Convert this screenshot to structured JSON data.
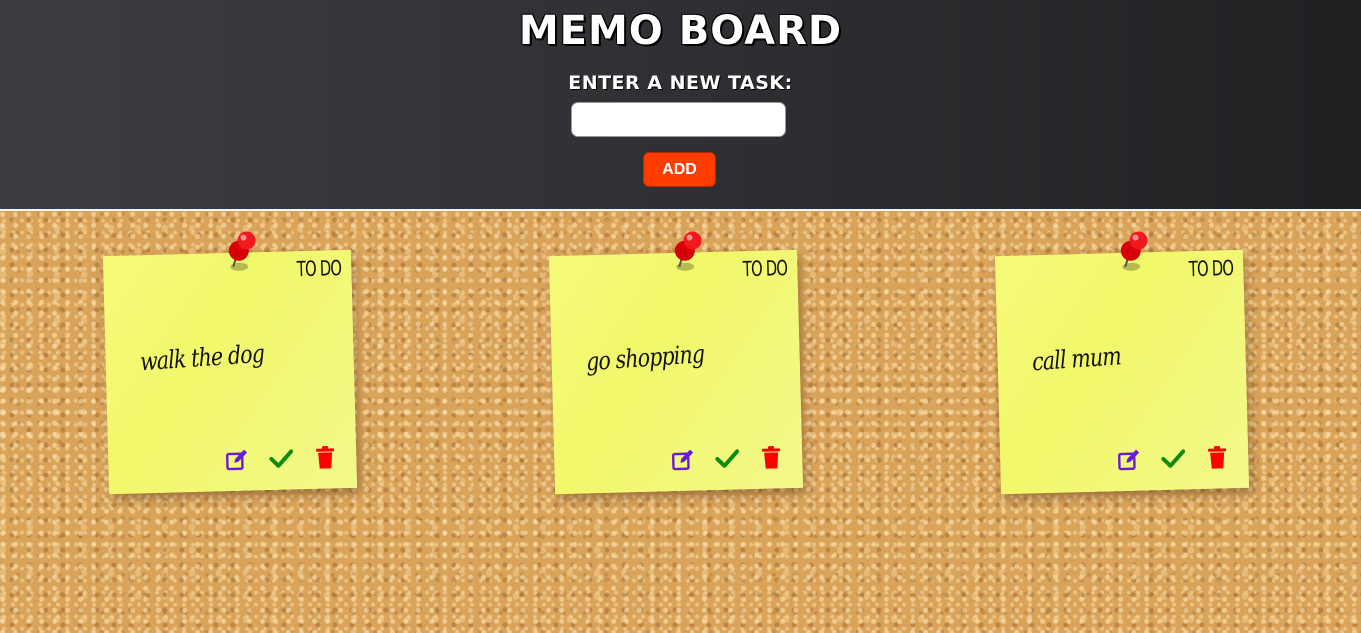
{
  "header": {
    "title": "MEMO BOARD",
    "input_label": "ENTER A NEW TASK:",
    "input_value": "",
    "input_placeholder": "",
    "add_label": "ADD"
  },
  "notes": [
    {
      "status": "TO DO",
      "text": "walk the dog"
    },
    {
      "status": "TO DO",
      "text": "go shopping"
    },
    {
      "status": "TO DO",
      "text": "call mum"
    }
  ],
  "icons": {
    "pin": "push-pin-icon",
    "edit": "edit-icon",
    "complete": "check-icon",
    "delete": "trash-icon"
  },
  "colors": {
    "header_bg": "#2f3033",
    "add_button": "#ff3d00",
    "note": "#f1f86a",
    "edit_icon": "#6a1bd8",
    "check_icon": "#0f8a12",
    "trash_icon": "#ff0000",
    "pin": "#e3060a"
  }
}
